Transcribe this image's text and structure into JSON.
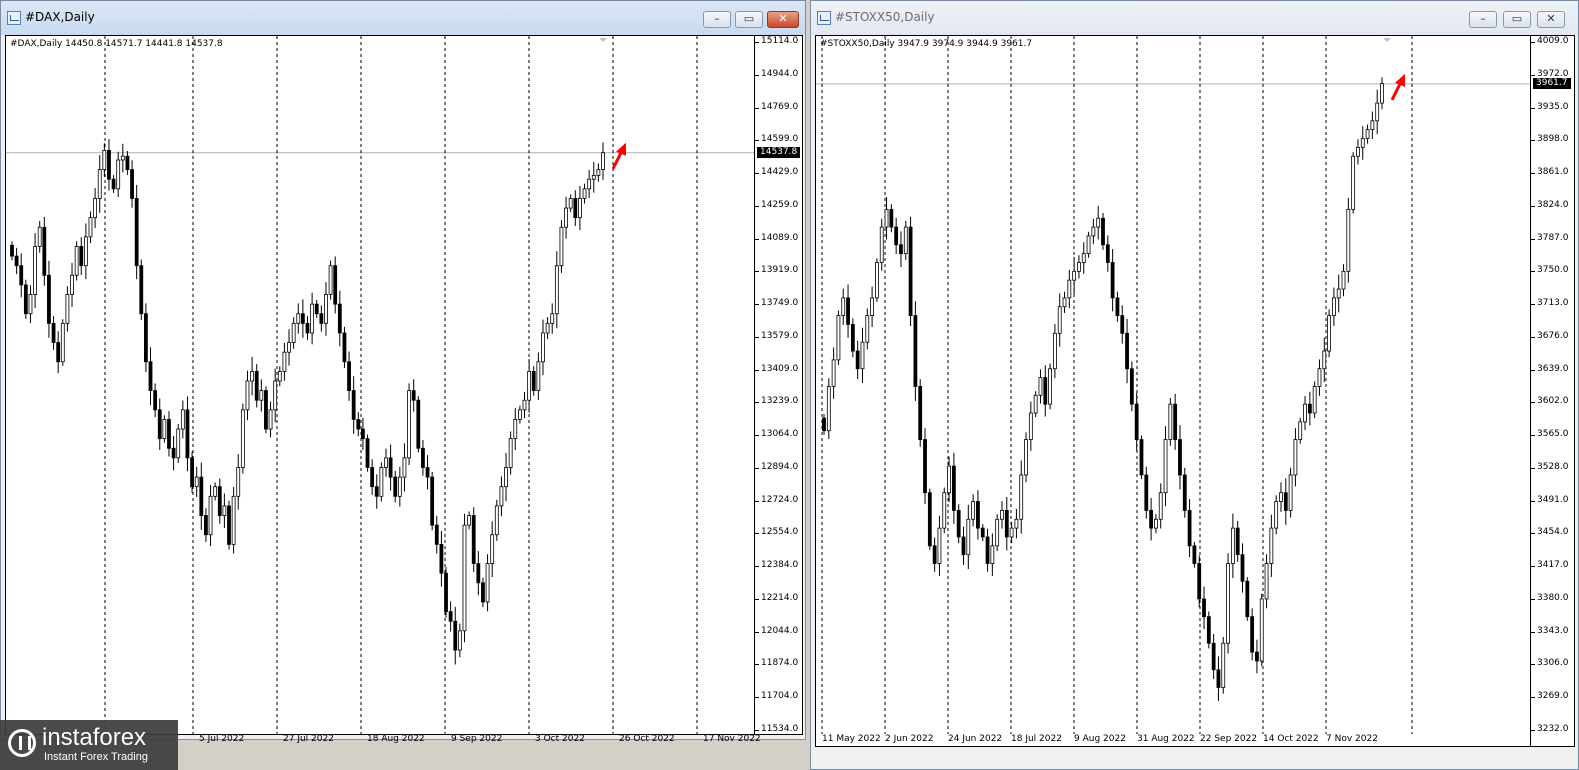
{
  "windows": [
    {
      "id": "dax",
      "title": "#DAX,Daily",
      "header": "#DAX,Daily   14450.8 14571.7 14441.8 14537.8",
      "active": true,
      "current_price": "14537.8",
      "price_labels": [
        "15114.0",
        "14944.0",
        "14769.0",
        "14599.0",
        "14429.0",
        "14259.0",
        "14089.0",
        "13919.0",
        "13749.0",
        "13579.0",
        "13409.0",
        "13239.0",
        "13064.0",
        "12894.0",
        "12724.0",
        "12554.0",
        "12384.0",
        "12214.0",
        "12044.0",
        "11874.0",
        "11704.0",
        "11534.0"
      ],
      "date_labels": [
        "5 Jul 2022",
        "27 Jul 2022",
        "18 Aug 2022",
        "9 Sep 2022",
        "3 Oct 2022",
        "26 Oct 2022",
        "17 Nov 2022"
      ]
    },
    {
      "id": "stoxx",
      "title": "#STOXX50,Daily",
      "header": "#STOXX50,Daily   3947.9 3974.9 3944.9 3961.7",
      "active": false,
      "current_price": "3961.7",
      "price_labels": [
        "4009.0",
        "3972.0",
        "3935.0",
        "3898.0",
        "3861.0",
        "3824.0",
        "3787.0",
        "3750.0",
        "3713.0",
        "3676.0",
        "3639.0",
        "3602.0",
        "3565.0",
        "3528.0",
        "3491.0",
        "3454.0",
        "3417.0",
        "3380.0",
        "3343.0",
        "3306.0",
        "3269.0",
        "3232.0"
      ],
      "date_labels": [
        "11 May 2022",
        "2 Jun 2022",
        "24 Jun 2022",
        "18 Jul 2022",
        "9 Aug 2022",
        "31 Aug 2022",
        "22 Sep 2022",
        "14 Oct 2022",
        "7 Nov 2022"
      ]
    }
  ],
  "controls": {
    "minimize": "–",
    "maximize": "▭",
    "close": "✕"
  },
  "logo": {
    "name": "instaforex",
    "tagline": "Instant Forex Trading"
  },
  "colors": {
    "candle_up": "#ffffff",
    "candle_down": "#000000",
    "arrow": "#ff0000",
    "grid": "#000000"
  },
  "chart_data": [
    {
      "type": "candlestick",
      "title": "#DAX,Daily",
      "last": {
        "open": 14450.8,
        "high": 14571.7,
        "low": 14441.8,
        "close": 14537.8
      },
      "ylim": [
        11534.0,
        15114.0
      ],
      "closes": [
        14000,
        13950,
        13850,
        13700,
        13800,
        14050,
        14150,
        13900,
        13650,
        13550,
        13450,
        13650,
        13800,
        13900,
        14050,
        13950,
        14100,
        14200,
        14300,
        14450,
        14550,
        14400,
        14350,
        14500,
        14520,
        14450,
        14300,
        13950,
        13700,
        13450,
        13300,
        13200,
        13050,
        13150,
        13000,
        12950,
        13100,
        13200,
        12950,
        12800,
        12850,
        12650,
        12550,
        12750,
        12800,
        12650,
        12700,
        12500,
        12750,
        12900,
        13200,
        13350,
        13400,
        13250,
        13300,
        13100,
        13200,
        13350,
        13400,
        13500,
        13550,
        13650,
        13700,
        13650,
        13600,
        13750,
        13700,
        13650,
        13800,
        13950,
        13750,
        13600,
        13450,
        13300,
        13150,
        13100,
        13050,
        12900,
        12800,
        12750,
        12900,
        12950,
        12850,
        12750,
        12850,
        12950,
        13300,
        13250,
        13000,
        12900,
        12850,
        12600,
        12500,
        12350,
        12150,
        12100,
        11950,
        12050,
        12600,
        12650,
        12400,
        12300,
        12200,
        12400,
        12550,
        12700,
        12800,
        12900,
        13050,
        13150,
        13200,
        13250,
        13400,
        13300,
        13450,
        13600,
        13650,
        13700,
        13950,
        14150,
        14250,
        14300,
        14200,
        14300,
        14350,
        14400,
        14420,
        14450,
        14538
      ]
    },
    {
      "type": "candlestick",
      "title": "#STOXX50,Daily",
      "last": {
        "open": 3947.9,
        "high": 3974.9,
        "low": 3944.9,
        "close": 3961.7
      },
      "ylim": [
        3232.0,
        4009.0
      ],
      "closes": [
        3570,
        3620,
        3650,
        3700,
        3720,
        3690,
        3660,
        3640,
        3670,
        3700,
        3720,
        3760,
        3800,
        3820,
        3800,
        3780,
        3770,
        3800,
        3700,
        3620,
        3560,
        3500,
        3440,
        3420,
        3460,
        3500,
        3530,
        3480,
        3450,
        3430,
        3470,
        3490,
        3460,
        3450,
        3420,
        3440,
        3470,
        3480,
        3450,
        3460,
        3470,
        3520,
        3560,
        3590,
        3610,
        3630,
        3600,
        3640,
        3680,
        3710,
        3720,
        3740,
        3750,
        3760,
        3770,
        3790,
        3800,
        3810,
        3780,
        3760,
        3720,
        3700,
        3680,
        3640,
        3600,
        3560,
        3520,
        3480,
        3460,
        3470,
        3500,
        3560,
        3600,
        3560,
        3520,
        3480,
        3440,
        3420,
        3380,
        3360,
        3330,
        3300,
        3280,
        3330,
        3420,
        3460,
        3430,
        3400,
        3360,
        3320,
        3310,
        3380,
        3420,
        3460,
        3490,
        3500,
        3480,
        3520,
        3560,
        3580,
        3600,
        3590,
        3620,
        3640,
        3660,
        3700,
        3720,
        3730,
        3750,
        3820,
        3880,
        3890,
        3900,
        3910,
        3920,
        3940,
        3962
      ]
    }
  ]
}
